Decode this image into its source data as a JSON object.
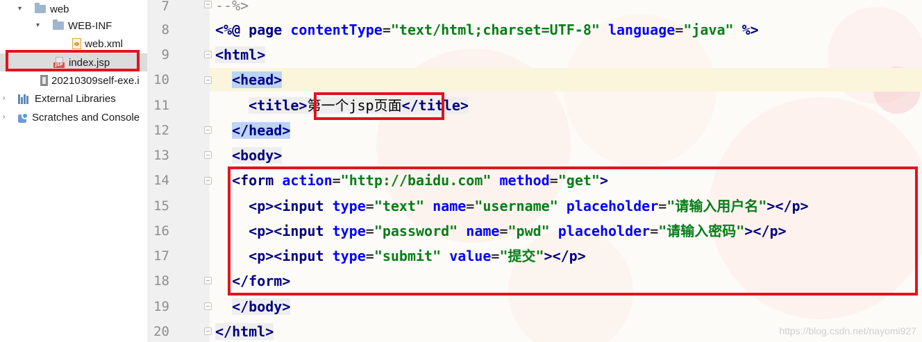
{
  "project_tree": {
    "items": [
      {
        "label": "web",
        "icon": "folder-icon",
        "expanded": true
      },
      {
        "label": "WEB-INF",
        "icon": "folder-icon",
        "expanded": true
      },
      {
        "label": "web.xml",
        "icon": "xml-file-icon"
      },
      {
        "label": "index.jsp",
        "icon": "jsp-file-icon",
        "selected": true
      },
      {
        "label": "20210309self-exe.i",
        "icon": "jar-file-icon"
      },
      {
        "label": "External Libraries",
        "icon": "library-icon",
        "expanded": false
      },
      {
        "label": "Scratches and Console",
        "icon": "scratches-icon",
        "expanded": false
      }
    ]
  },
  "editor": {
    "line_numbers": [
      "7",
      "8",
      "9",
      "10",
      "11",
      "12",
      "13",
      "14",
      "15",
      "16",
      "17",
      "18",
      "19",
      "20"
    ],
    "current_line": "10",
    "code": {
      "l7": "--%>",
      "l8_open": "<%@",
      "l8_page": "page",
      "l8_attr1": "contentType",
      "l8_val1": "\"text/html;charset=UTF-8\"",
      "l8_attr2": "language",
      "l8_val2": "\"java\"",
      "l8_close": "%>",
      "l9": "<html>",
      "l10": "<head>",
      "l11_open": "<title>",
      "l11_text": "第一个jsp页面",
      "l11_close": "</title>",
      "l12": "</head>",
      "l13": "<body>",
      "l14_open": "<form",
      "l14_attr1": "action",
      "l14_val1": "\"http://baidu.com\"",
      "l14_attr2": "method",
      "l14_val2": "\"get\"",
      "l14_close": ">",
      "p_open": "<p><input",
      "p_close": "></p>",
      "l15_attr1": "type",
      "l15_val1": "\"text\"",
      "l15_attr2": "name",
      "l15_val2": "\"username\"",
      "l15_attr3": "placeholder",
      "l15_val3": "\"请输入用户名\"",
      "l16_attr1": "type",
      "l16_val1": "\"password\"",
      "l16_attr2": "name",
      "l16_val2": "\"pwd\"",
      "l16_attr3": "placeholder",
      "l16_val3": "\"请输入密码\"",
      "l17_attr1": "type",
      "l17_val1": "\"submit\"",
      "l17_attr2": "value",
      "l17_val2": "\"提交\"",
      "l18": "</form>",
      "l19": "</body>",
      "l20": "</html>",
      "eq": "="
    }
  },
  "watermark": "https://blog.csdn.net/nayomi927",
  "colors": {
    "annotation_red": "#e0141e",
    "tag_navy": "#000080",
    "attribute_blue": "#0000ff",
    "string_green": "#067d17",
    "matched_tag_bg": "#bcd4f7"
  }
}
